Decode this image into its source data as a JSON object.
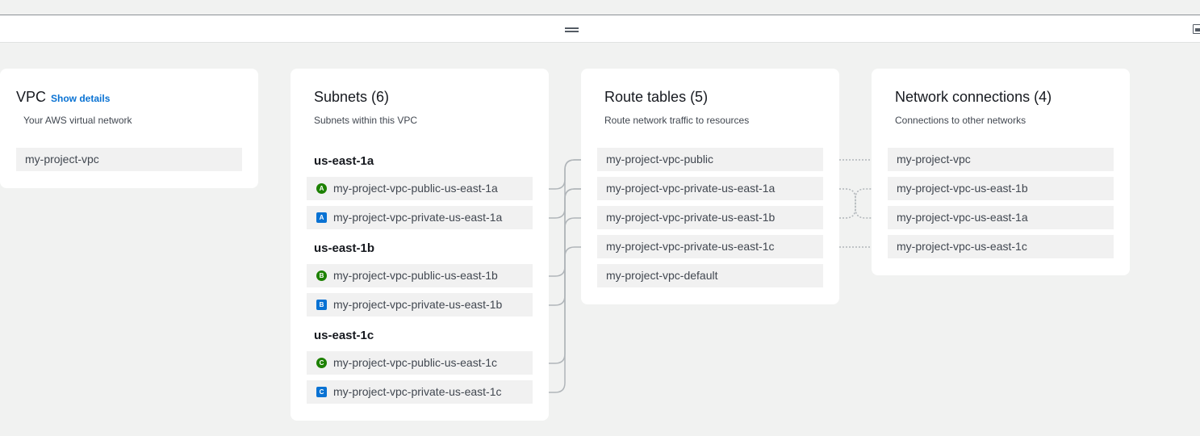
{
  "colors": {
    "background": "#f1f2f1",
    "card": "#ffffff",
    "item_bg": "#f1f1f1",
    "link": "#0972d3",
    "public_badge": "#1d8102",
    "private_badge": "#0972d3",
    "connector": "#b0b5b9"
  },
  "toolbar": {
    "drag_icon": "drag-handle-icon",
    "corner_icon": "panel-layout-icon"
  },
  "vpc": {
    "title": "VPC",
    "show_details": "Show details",
    "subtitle": "Your AWS virtual network",
    "item": "my-project-vpc"
  },
  "subnets": {
    "title": "Subnets (6)",
    "subtitle": "Subnets within this VPC",
    "zones": [
      {
        "name": "us-east-1a",
        "items": [
          {
            "badge": "A",
            "badge_type": "public",
            "label": "my-project-vpc-public-us-east-1a"
          },
          {
            "badge": "A",
            "badge_type": "private",
            "label": "my-project-vpc-private-us-east-1a"
          }
        ]
      },
      {
        "name": "us-east-1b",
        "items": [
          {
            "badge": "B",
            "badge_type": "public",
            "label": "my-project-vpc-public-us-east-1b"
          },
          {
            "badge": "B",
            "badge_type": "private",
            "label": "my-project-vpc-private-us-east-1b"
          }
        ]
      },
      {
        "name": "us-east-1c",
        "items": [
          {
            "badge": "C",
            "badge_type": "public",
            "label": "my-project-vpc-public-us-east-1c"
          },
          {
            "badge": "C",
            "badge_type": "private",
            "label": "my-project-vpc-private-us-east-1c"
          }
        ]
      }
    ]
  },
  "route_tables": {
    "title": "Route tables (5)",
    "subtitle": "Route network traffic to resources",
    "items": [
      "my-project-vpc-public",
      "my-project-vpc-private-us-east-1a",
      "my-project-vpc-private-us-east-1b",
      "my-project-vpc-private-us-east-1c",
      "my-project-vpc-default"
    ]
  },
  "network_connections": {
    "title": "Network connections (4)",
    "subtitle": "Connections to other networks",
    "items": [
      "my-project-vpc",
      "my-project-vpc-us-east-1b",
      "my-project-vpc-us-east-1a",
      "my-project-vpc-us-east-1c"
    ]
  }
}
